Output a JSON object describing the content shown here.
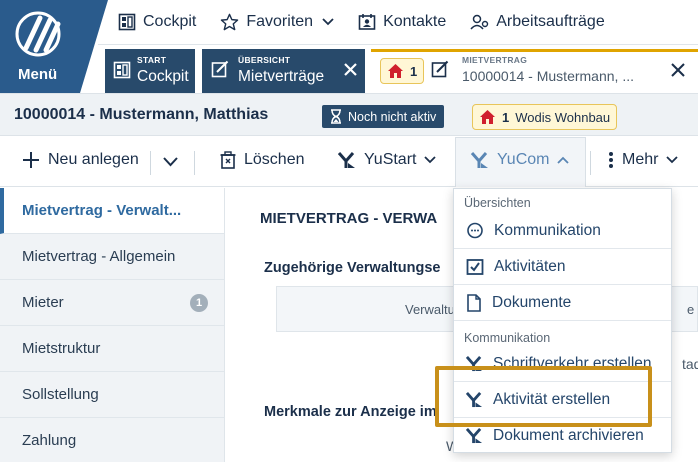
{
  "menu": {
    "label": "Menü"
  },
  "quicklinks": [
    {
      "label": "Cockpit",
      "icon": "cockpit-icon"
    },
    {
      "label": "Favoriten",
      "icon": "star-icon"
    },
    {
      "label": "Kontakte",
      "icon": "contacts-icon"
    },
    {
      "label": "Arbeitsaufträge",
      "icon": "work-orders-icon"
    }
  ],
  "tabs": [
    {
      "kicker": "START",
      "title": "Cockpit"
    },
    {
      "kicker": "ÜBERSICHT",
      "title": "Mietverträge"
    },
    {
      "kicker": "MIETVERTRAG",
      "title": "10000014 - Mustermann, ...",
      "badge_count": "1"
    }
  ],
  "record": {
    "title": "10000014 - Mustermann, Matthias",
    "status": "Noch nicht aktiv",
    "company_count": "1",
    "company_name": "Wodis Wohnbau"
  },
  "toolbar": {
    "new": "Neu anlegen",
    "delete": "Löschen",
    "yustart": "YuStart",
    "yucom": "YuCom",
    "more": "Mehr"
  },
  "sidebar": {
    "items": [
      {
        "label": "Mietvertrag - Verwalt..."
      },
      {
        "label": "Mietvertrag - Allgemein"
      },
      {
        "label": "Mieter",
        "count": "1"
      },
      {
        "label": "Mietstruktur"
      },
      {
        "label": "Sollstellung"
      },
      {
        "label": "Zahlung"
      }
    ]
  },
  "content": {
    "section_title": "MIETVERTRAG - VERWA",
    "sub1": "Zugehörige Verwaltungse",
    "col1": "Verwaltu",
    "col2": "e",
    "peek1": "tadt",
    "sub2": "Merkmale zur Anzeige im",
    "peek2": "W"
  },
  "dropdown": {
    "group1": "Übersichten",
    "items1": [
      "Kommunikation",
      "Aktivitäten",
      "Dokumente"
    ],
    "group2": "Kommunikation",
    "items2": [
      "Schriftverkehr erstellen",
      "Aktivität erstellen",
      "Dokument archivieren"
    ]
  },
  "colors": {
    "brand_dark": "#284a6b",
    "menu_blue": "#2a5b8c",
    "accent_yellow": "#e0a400",
    "highlight": "#c8901a",
    "link_blue": "#2f6aa0",
    "house_red": "#d0202e"
  }
}
